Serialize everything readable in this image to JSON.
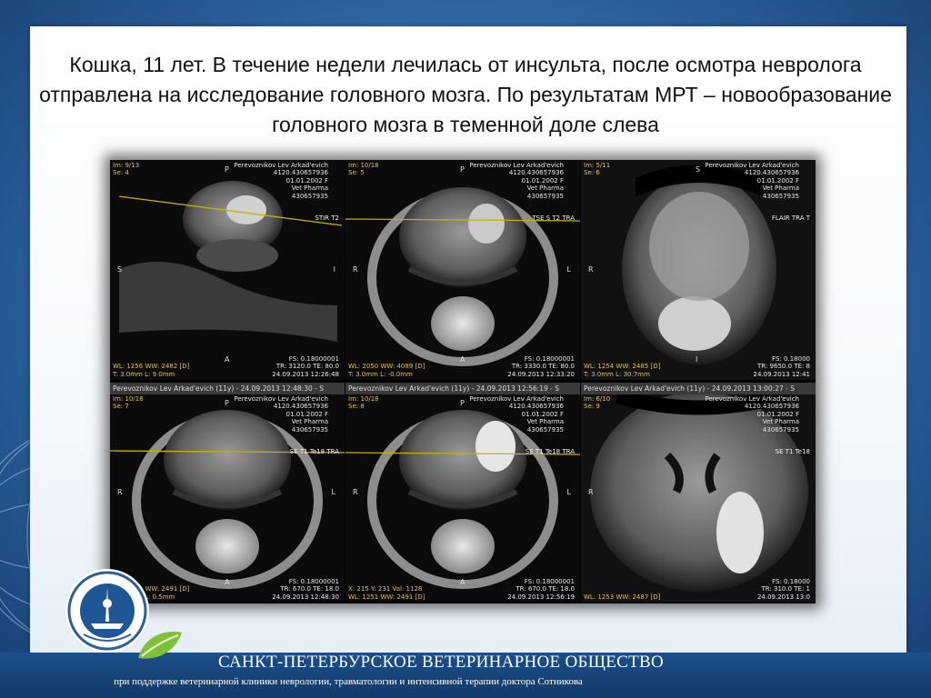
{
  "title": "Кошка, 11 лет. В течение недели лечилась от инсульта, после осмотра невролога отправлена на исследование головного мозга. По результатам МРТ – новообразование головного мозга в теменной доле слева",
  "footer": {
    "organization": "САНКТ-ПЕТЕРБУРСКОЕ ВЕТЕРИНАРНОЕ ОБЩЕСТВО",
    "support": "при поддержке ветеринарной клиники неврологии, травматологии и интенсивной терапии доктора Сотникова"
  },
  "mri": {
    "patient": "Perevoznikov Lev Arkad'evich\n4120.430657936\n01.01.2002 F\nVet Pharma\n430657935",
    "panels": [
      {
        "header": "",
        "tl": "Im: 9/13\nSe: 4",
        "seq": "STIR T2",
        "left": "S",
        "right": "I",
        "top": "P",
        "bottom": "A",
        "bl": "WL: 1256 WW: 2482 [D]\nT: 3.0mm L: 9.0mm",
        "br": "FS: 0.18000001\nTR: 3120.0 TE: 80.0\n24.09.2013 12:26:48"
      },
      {
        "header": "",
        "tl": "Im: 10/18\nSe: 5",
        "seq": "TSE S T2 TRA",
        "left": "R",
        "right": "L",
        "top": "P",
        "bottom": "A",
        "bl": "WL: 2050 WW: 4089 [D]\nT: 3.0mm L: -0.0mm",
        "br": "FS: 0.18000001\nTR: 3330.0 TE: 80.0\n24.09.2013 12:33:20"
      },
      {
        "header": "",
        "tl": "Im: 5/11\nSe: 6",
        "seq": "FLAIR TRA T",
        "left": "R",
        "right": "",
        "top": "S",
        "bottom": "I",
        "bl": "WL: 1254 WW: 2485 [D]\nT: 3.0mm L: 30.7mm",
        "br": "FS: 0.18000\nTR: 9650.0 TE: 8\n24.09.2013 12:41"
      },
      {
        "header": "Perevoznikov Lev Arkad'evich (11y) - 24.09.2013 12:48:30 - S",
        "tl": "Im: 10/18\nSe: 7",
        "seq": "SE T1 Te18 TRA",
        "left": "R",
        "right": "L",
        "top": "P",
        "bottom": "A",
        "bl": "WL: 1251 WW: 2491 [D]\nT: 3.0mm L: 0.5mm",
        "br": "FS: 0.18000001\nTR: 670.0 TE: 18.0\n24.09.2013 12:48:30"
      },
      {
        "header": "Perevoznikov Lev Arkad'evich (11y) - 24.09.2013 12:56:19 - S",
        "tl": "Im: 10/18\nSe: 8",
        "seq": "SE T1 Te18 TRA",
        "left": "R",
        "right": "L",
        "top": "P",
        "bottom": "A",
        "bl": "X: 215 Y: 231 Val: 1128\nWL: 1251 WW: 2491 [D]",
        "br": "FS: 0.18000001\nTR: 670.0 TE: 18.0\n24.09.2013 12:56:19"
      },
      {
        "header": "Perevoznikov Lev Arkad'evich (11y) - 24.09.2013 13:00:27 - S",
        "tl": "Im: 6/10\nSe: 9",
        "seq": "SE T1 Te18",
        "left": "R",
        "right": "",
        "top": "",
        "bottom": "",
        "bl": "WL: 1253 WW: 2487 [D]",
        "br": "FS: 0.18000\nTR: 310.0 TE: 1\n24.09.2013 13:0"
      }
    ]
  }
}
